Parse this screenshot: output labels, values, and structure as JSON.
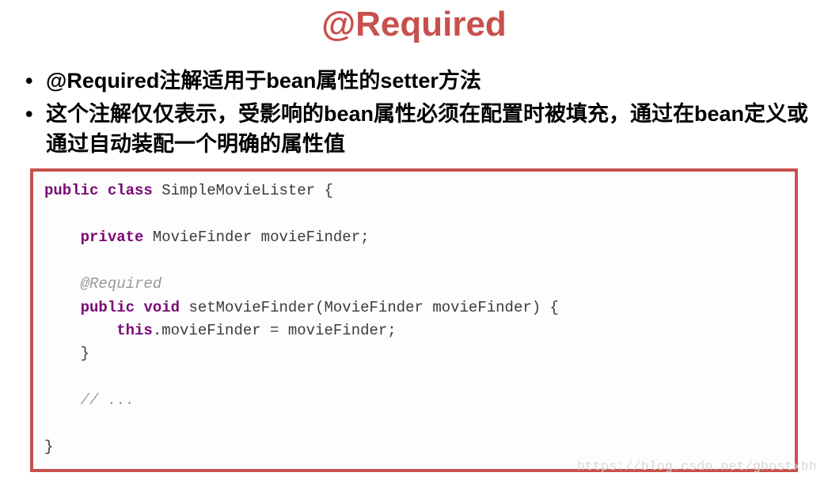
{
  "title": "@Required",
  "bullets": [
    "@Required注解适用于bean属性的setter方法",
    "这个注解仅仅表示，受影响的bean属性必须在配置时被填充，通过在bean定义或通过自动装配一个明确的属性值"
  ],
  "code": {
    "kw_public": "public",
    "kw_class": "class",
    "kw_private": "private",
    "kw_void": "void",
    "kw_this": "this",
    "class_name": "SimpleMovieLister",
    "field_type": "MovieFinder",
    "field_name": "movieFinder",
    "annotation": "@Required",
    "method_name": "setMovieFinder",
    "param_type": "MovieFinder",
    "param_name": "movieFinder",
    "assign_lhs": ".movieFinder",
    "assign_eq": " = ",
    "assign_rhs": "movieFinder;",
    "open_brace": " {",
    "close_brace": "}",
    "semi": ";",
    "paren_open": "(",
    "paren_close": ")",
    "comment": "// ..."
  },
  "watermark": "https://blog.csdn.net/ghostxbh"
}
